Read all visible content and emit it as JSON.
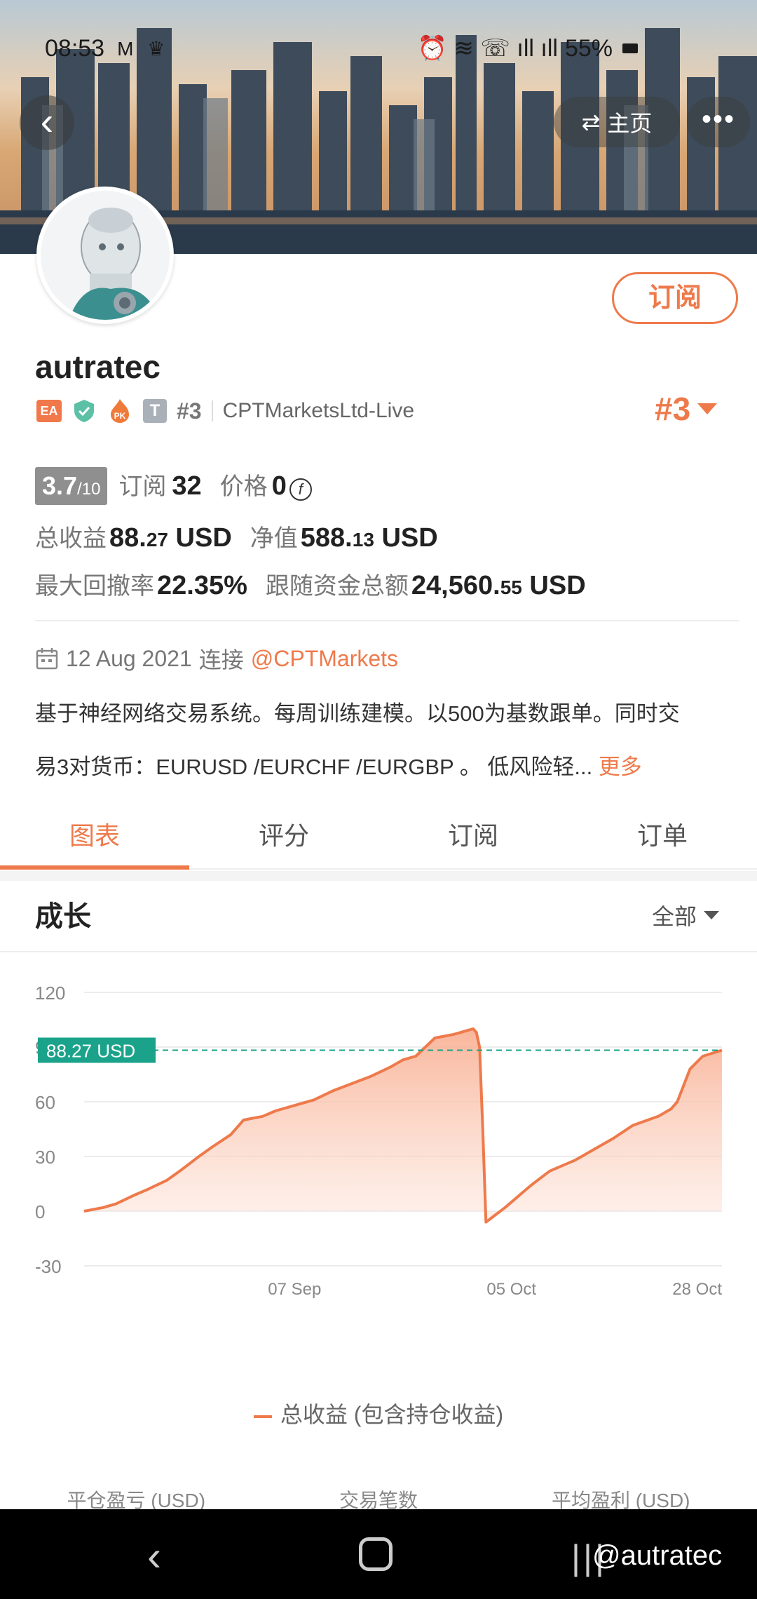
{
  "status_bar": {
    "time": "08:53",
    "left_icons": "M ♛",
    "right_icons": "⏰ ≋ ☏ ıll ıll",
    "battery": "55%"
  },
  "header": {
    "home_label": "主页",
    "more_label": "•••"
  },
  "profile": {
    "subscribe_label": "订阅",
    "username": "autratec",
    "badges": {
      "ea": "EA",
      "pk": "PK",
      "t": "T",
      "rank": "#3"
    },
    "broker": "CPTMarketsLtd-Live",
    "rank_big": "#3"
  },
  "stats": {
    "score": "3.7",
    "score_max": "/10",
    "subscribers_label": "订阅",
    "subscribers": "32",
    "price_label": "价格",
    "price": "0",
    "total_profit_label": "总收益",
    "total_profit_int": "88.",
    "total_profit_dec": "27",
    "total_profit_unit": "USD",
    "equity_label": "净值",
    "equity_int": "588.",
    "equity_dec": "13",
    "equity_unit": "USD",
    "max_drawdown_label": "最大回撤率",
    "max_drawdown": "22.35%",
    "follow_total_label": "跟随资金总额",
    "follow_total_int": "24,560.",
    "follow_total_dec": "55",
    "follow_total_unit": "USD"
  },
  "connect": {
    "date": "12 Aug 2021",
    "connect_label": "连接",
    "link": "@CPTMarkets"
  },
  "description": {
    "line1": "基于神经网络交易系统。每周训练建模。以500为基数跟单。同时交",
    "line2": "易3对货币：EURUSD /EURCHF /EURGBP 。 低风险轻...",
    "more": "更多"
  },
  "tabs": [
    {
      "label": "图表",
      "active": true
    },
    {
      "label": "评分",
      "active": false
    },
    {
      "label": "订阅",
      "active": false
    },
    {
      "label": "订单",
      "active": false
    }
  ],
  "section": {
    "title": "成长",
    "filter": "全部"
  },
  "chart_data": {
    "type": "area",
    "ylim": [
      -30,
      120
    ],
    "yticks": [
      120,
      90,
      60,
      30,
      0,
      -30
    ],
    "ytick_labels": [
      "120",
      "90",
      "60",
      "30",
      "0",
      "-30"
    ],
    "xtick_labels": [
      "07 Sep",
      "05 Oct",
      "28 Oct"
    ],
    "xtick_positions": [
      0.33,
      0.67,
      1.0
    ],
    "current_label": "88.27 USD",
    "current_value": 88.27,
    "series": [
      {
        "name": "总收益 (包含持仓收益)",
        "x": [
          0,
          0.03,
          0.05,
          0.08,
          0.1,
          0.13,
          0.15,
          0.18,
          0.2,
          0.23,
          0.25,
          0.28,
          0.3,
          0.33,
          0.36,
          0.39,
          0.42,
          0.45,
          0.48,
          0.5,
          0.52,
          0.55,
          0.58,
          0.6,
          0.61,
          0.615,
          0.62,
          0.625,
          0.63,
          0.66,
          0.7,
          0.73,
          0.77,
          0.8,
          0.83,
          0.86,
          0.9,
          0.92,
          0.93,
          0.95,
          0.97,
          1.0
        ],
        "y": [
          0,
          2,
          4,
          9,
          12,
          17,
          22,
          30,
          35,
          42,
          50,
          52,
          55,
          58,
          61,
          66,
          70,
          74,
          79,
          83,
          85,
          95,
          97,
          99,
          100,
          98,
          90,
          45,
          -6,
          2,
          14,
          22,
          28,
          34,
          40,
          47,
          52,
          56,
          60,
          78,
          85,
          88.27
        ]
      }
    ]
  },
  "legend": {
    "label": "总收益 (包含持仓收益)"
  },
  "bottom_stats": [
    "平仓盈亏 (USD)",
    "交易笔数",
    "平均盈利 (USD)"
  ],
  "navbar": {
    "back": "‹",
    "recent": "|||",
    "watermark": "@autratec"
  }
}
